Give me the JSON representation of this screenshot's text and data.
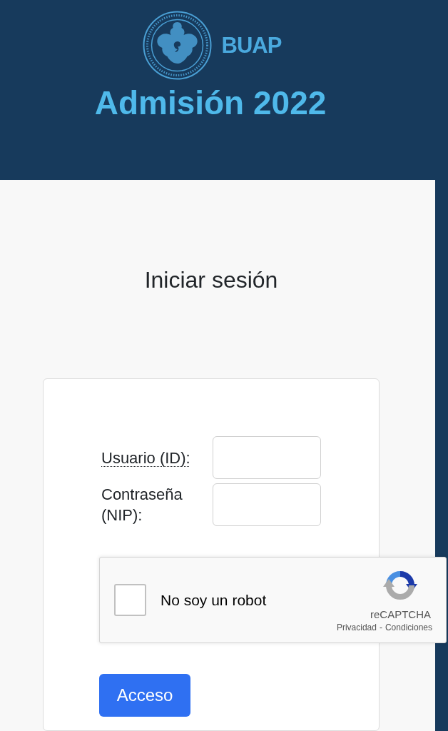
{
  "header": {
    "brand": "BUAP",
    "title": "Admisión 2022"
  },
  "login": {
    "heading": "Iniciar sesión",
    "fields": [
      {
        "label": "Usuario (ID):",
        "kind": "abbr"
      },
      {
        "label": "Contraseña (NIP):",
        "kind": "plain"
      }
    ],
    "captcha": {
      "label": "No soy un robot",
      "checked": false,
      "brand": "reCAPTCHA",
      "privacy": "Privacidad",
      "separator": "-",
      "terms": "Condiciones"
    },
    "submit": "Acceso"
  }
}
